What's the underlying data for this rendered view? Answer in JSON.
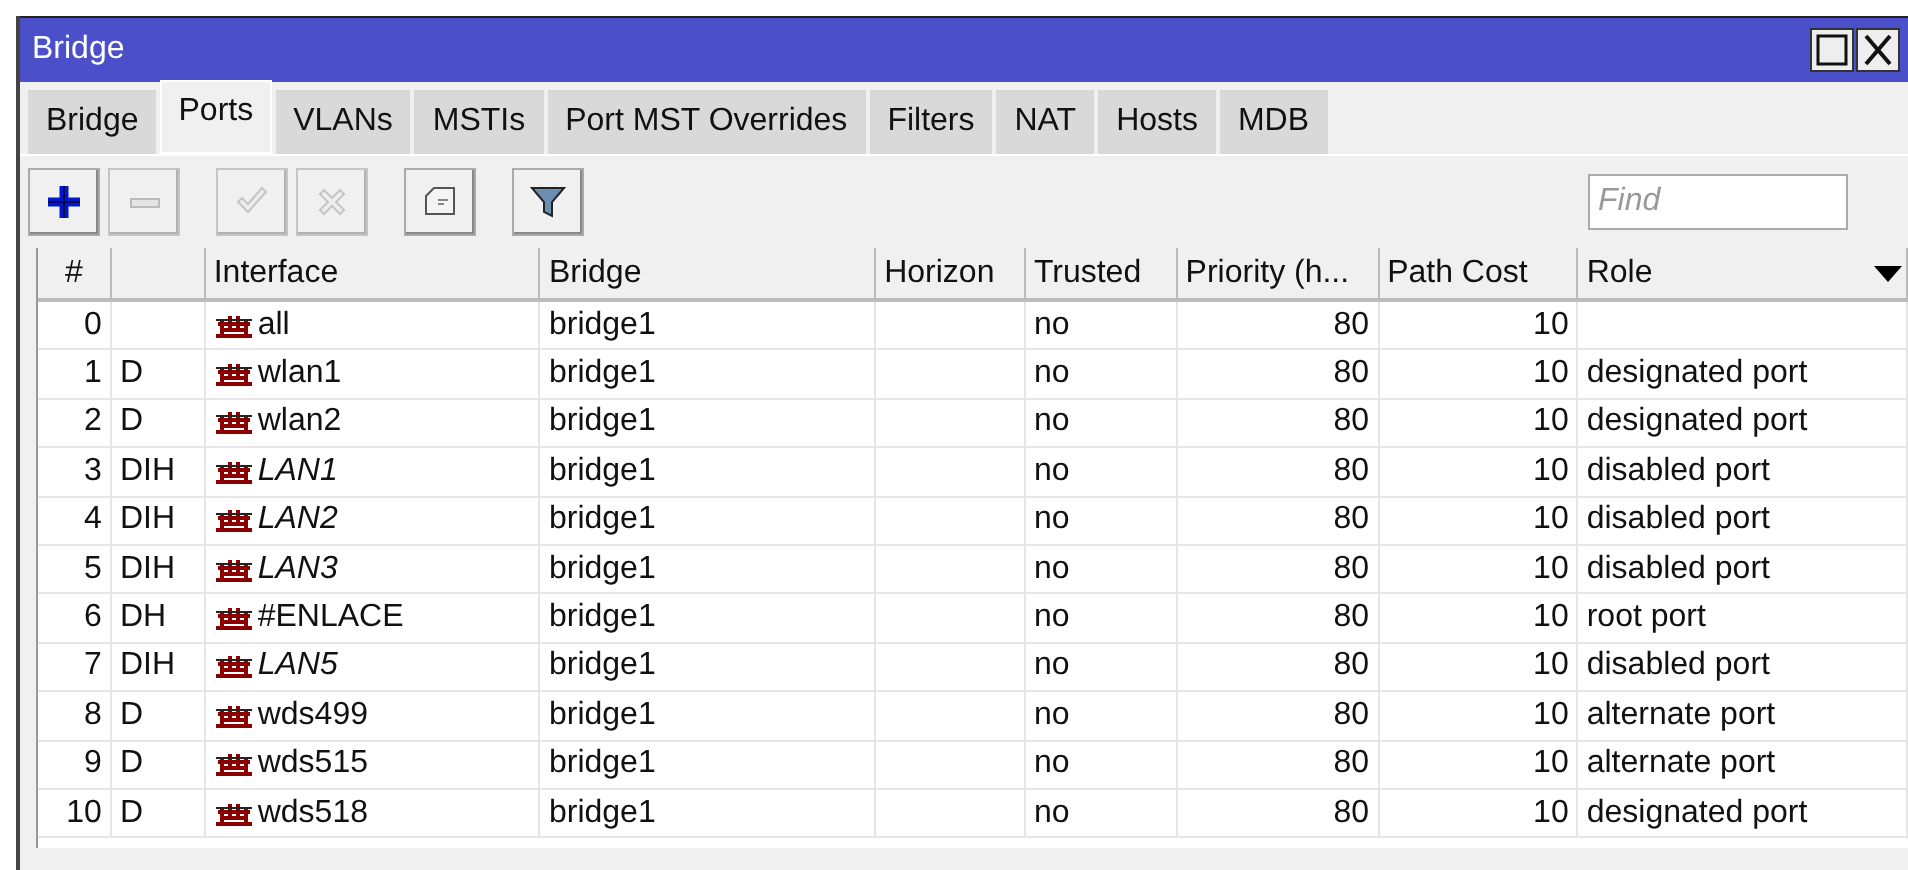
{
  "window": {
    "title": "Bridge"
  },
  "tabs": [
    {
      "label": "Bridge",
      "selected": false
    },
    {
      "label": "Ports",
      "selected": true
    },
    {
      "label": "VLANs",
      "selected": false
    },
    {
      "label": "MSTIs",
      "selected": false
    },
    {
      "label": "Port MST Overrides",
      "selected": false
    },
    {
      "label": "Filters",
      "selected": false
    },
    {
      "label": "NAT",
      "selected": false
    },
    {
      "label": "Hosts",
      "selected": false
    },
    {
      "label": "MDB",
      "selected": false
    }
  ],
  "toolbar": [
    {
      "kind": "add",
      "disabled": false
    },
    {
      "kind": "remove",
      "disabled": true
    },
    {
      "kind": "enable",
      "disabled": true
    },
    {
      "kind": "disable",
      "disabled": true
    },
    {
      "kind": "comment",
      "disabled": false
    },
    {
      "kind": "filter",
      "disabled": false
    }
  ],
  "search": {
    "placeholder": "Find"
  },
  "table": {
    "columns": [
      "#",
      "",
      "Interface",
      "Bridge",
      "Horizon",
      "Trusted",
      "Priority (h...",
      "Path Cost",
      "Role"
    ],
    "rows": [
      {
        "num": "0",
        "flags": "",
        "interface": "all",
        "inactive": false,
        "bridge": "bridge1",
        "horizon": "",
        "trusted": "no",
        "priority": "80",
        "path_cost": "10",
        "role": ""
      },
      {
        "num": "1",
        "flags": "D",
        "interface": "wlan1",
        "inactive": false,
        "bridge": "bridge1",
        "horizon": "",
        "trusted": "no",
        "priority": "80",
        "path_cost": "10",
        "role": "designated port"
      },
      {
        "num": "2",
        "flags": "D",
        "interface": "wlan2",
        "inactive": false,
        "bridge": "bridge1",
        "horizon": "",
        "trusted": "no",
        "priority": "80",
        "path_cost": "10",
        "role": "designated port"
      },
      {
        "num": "3",
        "flags": "DIH",
        "interface": "LAN1",
        "inactive": true,
        "bridge": "bridge1",
        "horizon": "",
        "trusted": "no",
        "priority": "80",
        "path_cost": "10",
        "role": "disabled port"
      },
      {
        "num": "4",
        "flags": "DIH",
        "interface": "LAN2",
        "inactive": true,
        "bridge": "bridge1",
        "horizon": "",
        "trusted": "no",
        "priority": "80",
        "path_cost": "10",
        "role": "disabled port"
      },
      {
        "num": "5",
        "flags": "DIH",
        "interface": "LAN3",
        "inactive": true,
        "bridge": "bridge1",
        "horizon": "",
        "trusted": "no",
        "priority": "80",
        "path_cost": "10",
        "role": "disabled port"
      },
      {
        "num": "6",
        "flags": "DH",
        "interface": "#ENLACE",
        "inactive": false,
        "bridge": "bridge1",
        "horizon": "",
        "trusted": "no",
        "priority": "80",
        "path_cost": "10",
        "role": "root port"
      },
      {
        "num": "7",
        "flags": "DIH",
        "interface": "LAN5",
        "inactive": true,
        "bridge": "bridge1",
        "horizon": "",
        "trusted": "no",
        "priority": "80",
        "path_cost": "10",
        "role": "disabled port"
      },
      {
        "num": "8",
        "flags": "D",
        "interface": "wds499",
        "inactive": false,
        "bridge": "bridge1",
        "horizon": "",
        "trusted": "no",
        "priority": "80",
        "path_cost": "10",
        "role": "alternate port"
      },
      {
        "num": "9",
        "flags": "D",
        "interface": "wds515",
        "inactive": false,
        "bridge": "bridge1",
        "horizon": "",
        "trusted": "no",
        "priority": "80",
        "path_cost": "10",
        "role": "alternate port"
      },
      {
        "num": "10",
        "flags": "D",
        "interface": "wds518",
        "inactive": false,
        "bridge": "bridge1",
        "horizon": "",
        "trusted": "no",
        "priority": "80",
        "path_cost": "10",
        "role": "designated port"
      }
    ]
  }
}
